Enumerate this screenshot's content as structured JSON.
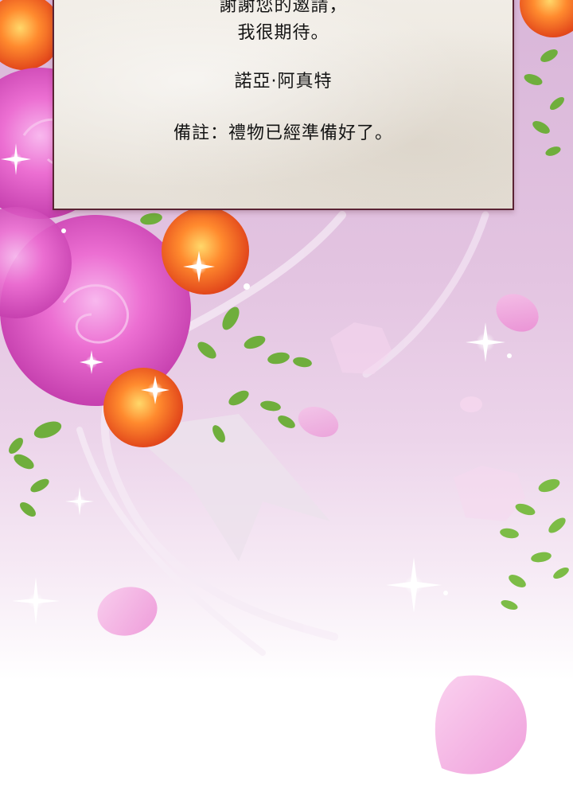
{
  "letter": {
    "line1": "謝謝您的邀請，",
    "line2": "我很期待。",
    "signature": "諾亞·阿真特",
    "postscript": "備註：禮物已經準備好了。"
  },
  "colors": {
    "background_top": "#d9b6d9",
    "background_bottom": "#ffffff",
    "letter_paper": "#ebe6de",
    "letter_border": "#5a2334",
    "text": "#141414",
    "rose_pink": "#e85fc8",
    "rose_orange": "#f26a2a",
    "leaf_green": "#6fae3c"
  }
}
